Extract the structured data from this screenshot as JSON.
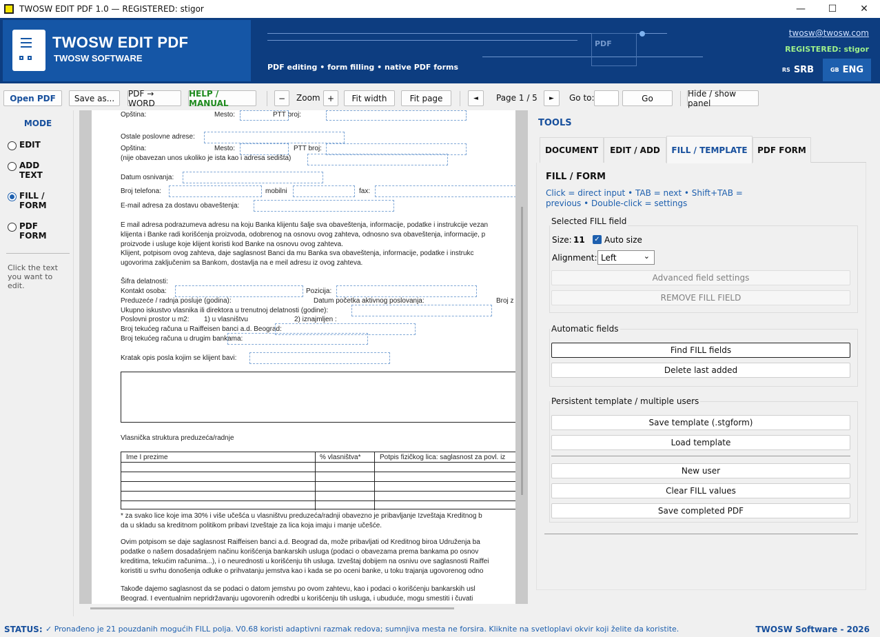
{
  "window": {
    "title": "TWOSW EDIT PDF 1.0 — REGISTERED: stigor",
    "minimize": "—",
    "maximize": "☐",
    "close": "✕"
  },
  "banner": {
    "app_name": "TWOSW EDIT PDF",
    "company": "TWOSW SOFTWARE",
    "tagline": "PDF editing • form filling • native PDF forms",
    "email": "twosw@twosw.com",
    "registered": "REGISTERED: stigor",
    "pdf_watermark": "PDF",
    "lang": [
      {
        "flag": "RS",
        "label": "SRB"
      },
      {
        "flag": "GB",
        "label": "ENG"
      }
    ],
    "colors": {
      "banner": "#0d3d80",
      "brand_box": "#1556a6",
      "eng_active": "#1d5fae",
      "registered_text": "#9ff28a"
    }
  },
  "toolbar": {
    "open_pdf": "Open PDF",
    "save_as": "Save as...",
    "pdf_word": "PDF → WORD",
    "help": "HELP / MANUAL",
    "zoom_out": "−",
    "zoom_label": "Zoom",
    "zoom_in": "+",
    "fit_width": "Fit width",
    "fit_page": "Fit page",
    "prev_page": "◄",
    "page_indicator": "Page 1 / 5",
    "next_page": "►",
    "goto_label": "Go to:",
    "goto_value": "",
    "go": "Go",
    "hide_panel": "Hide / show panel"
  },
  "mode": {
    "title": "MODE",
    "options": [
      {
        "label": "EDIT",
        "selected": false
      },
      {
        "label": "ADD\nTEXT",
        "selected": false
      },
      {
        "label": "FILL /\nFORM",
        "selected": true
      },
      {
        "label": "PDF\nFORM",
        "selected": false
      }
    ],
    "hint": "Click the text you want to edit."
  },
  "document": {
    "lines": [
      "Opština:",
      "Mesto:",
      "PTT broj:",
      "Ostale poslovne adrese:",
      "Opština:",
      "Mesto:",
      "PTT broj:",
      "(nije obavezan unos ukoliko je ista kao i adresa sedišta)",
      "Datum osnivanja:",
      "Broj telefona:",
      "mobilni",
      "fax:",
      "E-mail adresa za dostavu obaveštenja:",
      "E mail adresa podrazumeva adresu na koju Banka klijentu šalje sva obaveštenja, informacije, podatke i instrukcije vezan",
      "klijenta i Banke radi korišćenja proizvoda, odobrenog na osnovu ovog zahteva, odnosno sva obaveštenja, informacije, p",
      "proizvode i usluge koje klijent koristi kod Banke na osnovu ovog zahteva.",
      "Klijent, potpisom ovog zahteva, daje saglasnost Banci da mu Banka sva obaveštenja, informacije, podatke i instrukc",
      "ugovorima zaključenim sa Bankom, dostavlja na e meil adresu iz ovog zahteva.",
      "Šifra delatnosti:",
      "Kontakt osoba:",
      "Pozicija:",
      "Preduzeće / radnja posluje (godina):",
      "Datum početka aktivnog poslovanja:",
      "Broj z",
      "Ukupno iskustvo vlasnika ili direktora u trenutnoj delatnosti (godine):",
      "Poslovni prostor u m2:",
      "1)  u vlasništvu",
      "2) iznajmljen :",
      "Broj tekućeg računa u Raiffeisen banci a.d. Beograd:",
      "Broj tekućeg računa u drugim bankama:",
      "Kratak opis posla kojim se klijent bavi:",
      "Vlasnička struktura preduzeća/radnje",
      "Ime I prezime",
      "% vlasništva*",
      "Potpis fizičkog lica: saglasnost za povl. iz",
      "* za svako lice koje ima 30% i više učešća u vlasništvu  preduzeća/radnji obavezno je pribavljanje  Izveštaja Kreditnog b",
      "da u skladu sa kreditnom politikom pribavi Izveštaje za lica koja imaju i manje učešće.",
      "Ovim potpisom se daje saglasnost Raiffeisen banci a.d. Beograd da, može pribavljati od Kreditnog biroa Udruženja ba",
      "podatke o našem dosadašnjem načinu korišćenja bankarskih usluga (podaci o obavezama prema bankama po osnov",
      "kreditima, tekućim računima...), i o neurednosti u korišćenju tih usluga. Izveštaj dobijem na osnivu ove saglasnosti Raiffei",
      "koristiti u svrhu donošenja odluke o prihvatanju jemstva kao i kada se po oceni banke, u toku trajanja ugovorenog odno",
      "Takođe dajemo saglasnost da se podaci o datom jemstvu po ovom zahtevu, kao i podaci o korišćenju bankarskih usl",
      "Beograd. I eventualnim nepridržavanju ugovorenih odredbi u korišćenju tih usluga, i ubuduće, mogu smestiti i čuvati"
    ]
  },
  "tools": {
    "title": "TOOLS",
    "tabs": [
      {
        "label": "DOCUMENT",
        "active": false
      },
      {
        "label": "EDIT / ADD",
        "active": false
      },
      {
        "label": "FILL / TEMPLATE",
        "active": true
      },
      {
        "label": "PDF FORM",
        "active": false
      }
    ],
    "fill": {
      "heading": "FILL / FORM",
      "hint": "Click = direct input • TAB = next • Shift+TAB = previous • Double-click = settings",
      "selected_group": "Selected FILL field",
      "size_label": "Size:",
      "size_value": "11",
      "autosize_label": "Auto size",
      "autosize_checked": true,
      "alignment_label": "Alignment:",
      "alignment_value": "Left",
      "advanced": "Advanced field settings",
      "remove": "REMOVE FILL FIELD",
      "automatic_group": "Automatic fields",
      "find": "Find FILL fields",
      "delete_last": "Delete last added",
      "persistent_group": "Persistent template / multiple users",
      "save_template": "Save template (.stgform)",
      "load_template": "Load template",
      "new_user": "New user",
      "clear": "Clear FILL values",
      "save_completed": "Save completed PDF"
    }
  },
  "status": {
    "label": "STATUS:",
    "message": "✓ Pronađeno je 21 pouzdanih mogućih FILL polja. V0.68 koristi adaptivni razmak redova; sumnjiva mesta ne forsira. Kliknite na svetloplavi okvir koji želite da koristite.",
    "right": "TWOSW Software - 2026"
  }
}
